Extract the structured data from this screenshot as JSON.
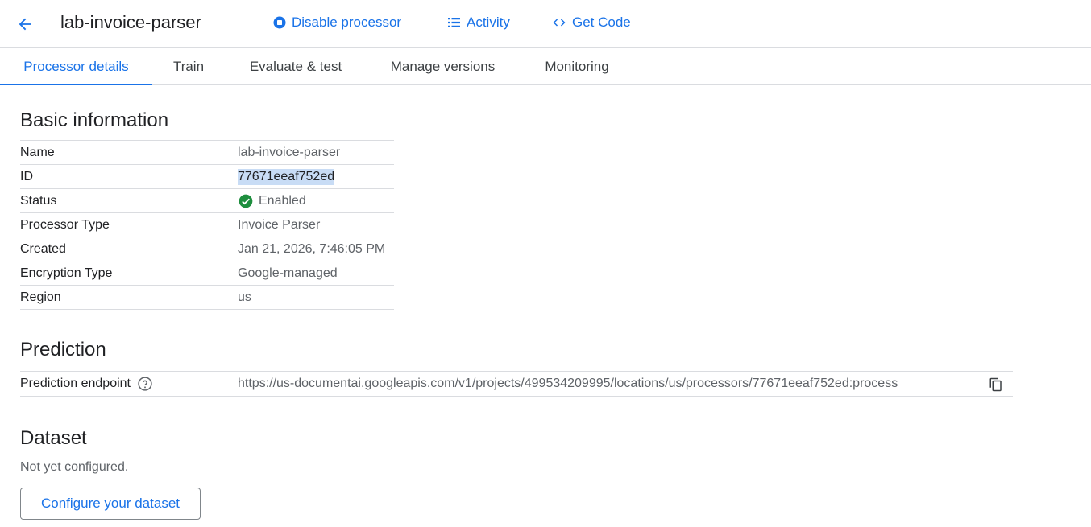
{
  "header": {
    "title": "lab-invoice-parser",
    "actions": [
      {
        "label": "Disable processor",
        "icon": "stop-circle-icon"
      },
      {
        "label": "Activity",
        "icon": "list-icon"
      },
      {
        "label": "Get Code",
        "icon": "code-icon"
      }
    ]
  },
  "tabs": [
    {
      "label": "Processor details",
      "active": true
    },
    {
      "label": "Train"
    },
    {
      "label": "Evaluate & test"
    },
    {
      "label": "Manage versions"
    },
    {
      "label": "Monitoring"
    }
  ],
  "basic_info": {
    "title": "Basic information",
    "rows": [
      {
        "key": "Name",
        "value": "lab-invoice-parser"
      },
      {
        "key": "ID",
        "value": "77671eeaf752ed"
      },
      {
        "key": "Status",
        "value": "Enabled"
      },
      {
        "key": "Processor Type",
        "value": "Invoice Parser"
      },
      {
        "key": "Created",
        "value": "Jan 21, 2026, 7:46:05 PM"
      },
      {
        "key": "Encryption Type",
        "value": "Google-managed"
      },
      {
        "key": "Region",
        "value": "us"
      }
    ]
  },
  "prediction": {
    "title": "Prediction",
    "endpoint_label": "Prediction endpoint",
    "endpoint_value": "https://us-documentai.googleapis.com/v1/projects/499534209995/locations/us/processors/77671eeaf752ed:process"
  },
  "dataset": {
    "title": "Dataset",
    "status": "Not yet configured.",
    "button_label": "Configure your dataset"
  },
  "colors": {
    "accent": "#1a73e8",
    "success": "#1e8e3e",
    "border": "#dadce0"
  }
}
